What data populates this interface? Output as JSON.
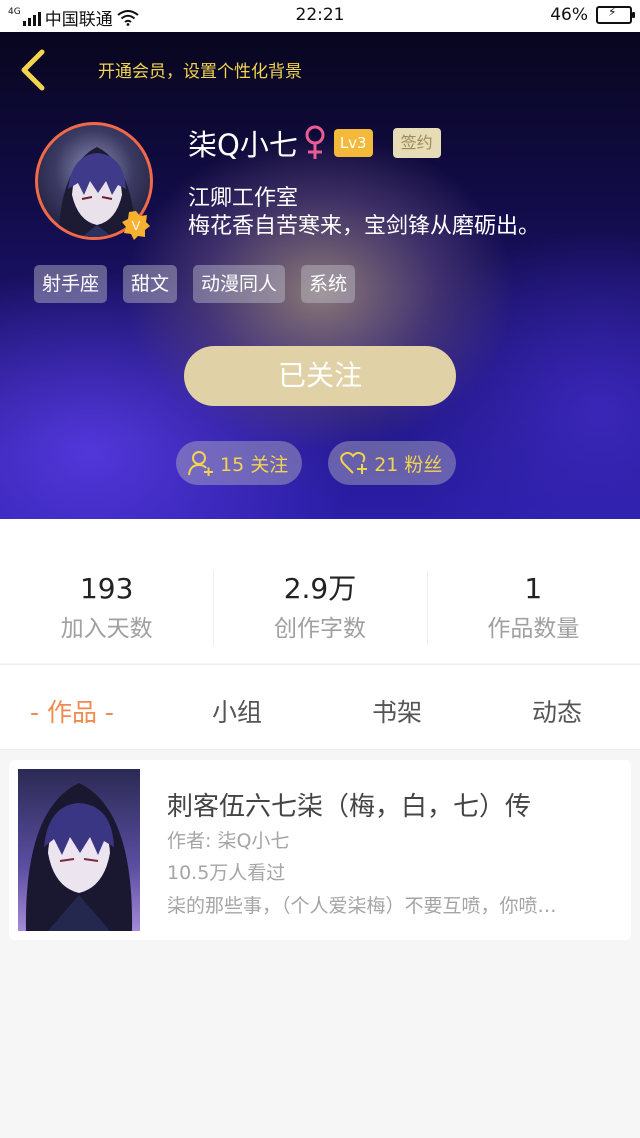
{
  "status_bar": {
    "network": "4G",
    "carrier": "中国联通",
    "time": "22:21",
    "battery": "46%"
  },
  "header": {
    "vip_prompt": "开通会员，设置个性化背景",
    "username": "柒Q小七",
    "level": "Lv3",
    "sign_badge": "签约",
    "studio": "江卿工作室",
    "motto": "梅花香自苦寒来，宝剑锋从磨砺出。",
    "tags": [
      "射手座",
      "甜文",
      "动漫同人",
      "系统"
    ],
    "follow_button": "已关注",
    "following_label": "15 关注",
    "fans_label": "21 粉丝"
  },
  "stats": [
    {
      "value": "193",
      "label": "加入天数"
    },
    {
      "value": "2.9万",
      "label": "创作字数"
    },
    {
      "value": "1",
      "label": "作品数量"
    }
  ],
  "tabs": [
    {
      "label": "- 作品 -",
      "active": true
    },
    {
      "label": "小组",
      "active": false
    },
    {
      "label": "书架",
      "active": false
    },
    {
      "label": "动态",
      "active": false
    }
  ],
  "works": [
    {
      "title": "刺客伍六七柒（梅，白，七）传",
      "author": "作者: 柒Q小七",
      "views": "10.5万人看过",
      "description": "柒的那些事，（个人爱柒梅）不要互喷，你喷…"
    }
  ],
  "colors": {
    "accent_orange": "#f08a4e",
    "vip_yellow": "#f2d44e",
    "level_badge": "#f4b93a",
    "follow_button": "#e0d2a6"
  }
}
